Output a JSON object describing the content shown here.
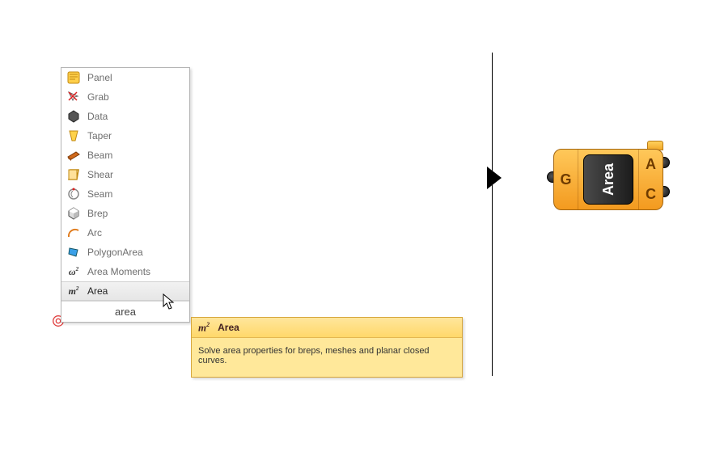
{
  "menu": {
    "items": [
      {
        "label": "Panel",
        "icon": "panel"
      },
      {
        "label": "Grab",
        "icon": "grab"
      },
      {
        "label": "Data",
        "icon": "data"
      },
      {
        "label": "Taper",
        "icon": "taper"
      },
      {
        "label": "Beam",
        "icon": "beam"
      },
      {
        "label": "Shear",
        "icon": "shear"
      },
      {
        "label": "Seam",
        "icon": "seam"
      },
      {
        "label": "Brep",
        "icon": "brep"
      },
      {
        "label": "Arc",
        "icon": "arc"
      },
      {
        "label": "PolygonArea",
        "icon": "polygonarea"
      },
      {
        "label": "Area Moments",
        "icon": "areamoments"
      },
      {
        "label": "Area",
        "icon": "area",
        "selected": true
      }
    ],
    "search_value": "area"
  },
  "tooltip": {
    "title": "Area",
    "description": "Solve area properties for breps, meshes and planar closed curves."
  },
  "node": {
    "core_label": "Area",
    "input_label": "G",
    "output_labels": [
      "A",
      "C"
    ]
  }
}
